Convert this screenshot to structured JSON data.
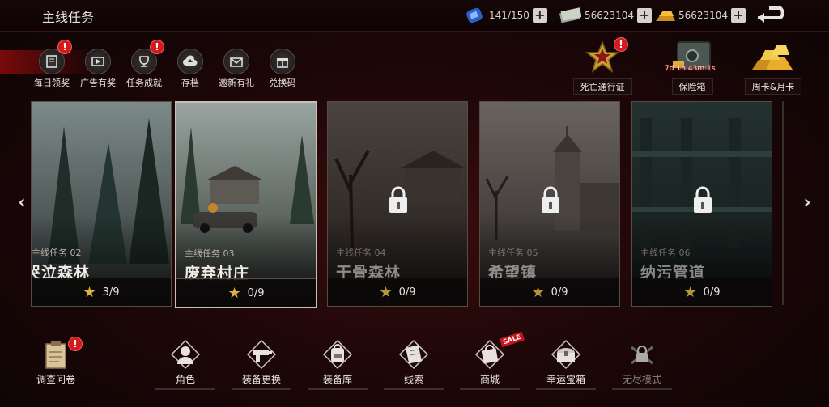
{
  "header": {
    "title": "主线任务"
  },
  "resources": [
    {
      "icon": "energy-can-icon",
      "value": "141/150"
    },
    {
      "icon": "cash-stack-icon",
      "value": "56623104"
    },
    {
      "icon": "gold-bars-icon",
      "value": "56623104"
    }
  ],
  "quick_actions": [
    {
      "label": "每日领奖",
      "icon": "daily-reward-icon",
      "badge": "!"
    },
    {
      "label": "广告有奖",
      "icon": "video-ad-icon",
      "badge": ""
    },
    {
      "label": "任务成就",
      "icon": "trophy-icon",
      "badge": "!"
    },
    {
      "label": "存档",
      "icon": "cloud-save-icon",
      "badge": ""
    },
    {
      "label": "邀新有礼",
      "icon": "invite-envelope-icon",
      "badge": ""
    },
    {
      "label": "兑换码",
      "icon": "gift-code-icon",
      "badge": ""
    }
  ],
  "features": [
    {
      "label": "死亡通行证",
      "icon": "star-emblem-icon",
      "badge": "!",
      "timer": ""
    },
    {
      "label": "保险箱",
      "icon": "safe-icon",
      "badge": "",
      "timer": "7d:1h:43m:1s"
    },
    {
      "label": "周卡&月卡",
      "icon": "gold-pile-icon",
      "badge": "",
      "timer": ""
    }
  ],
  "missions": [
    {
      "subtitle": "主线任务 02",
      "name": "哭泣森林",
      "stars": "3/9",
      "locked": false
    },
    {
      "subtitle": "主线任务 03",
      "name": "废弃村庄",
      "stars": "0/9",
      "locked": false
    },
    {
      "subtitle": "主线任务 04",
      "name": "干骨森林",
      "stars": "0/9",
      "locked": true
    },
    {
      "subtitle": "主线任务 05",
      "name": "希望镇",
      "stars": "0/9",
      "locked": true
    },
    {
      "subtitle": "主线任务 06",
      "name": "纳污管道",
      "stars": "0/9",
      "locked": true
    }
  ],
  "bottom_nav": [
    {
      "label": "调查问卷",
      "icon": "survey-clipboard-icon",
      "badge": "!"
    },
    {
      "label": "角色",
      "icon": "character-icon",
      "badge": ""
    },
    {
      "label": "装备更换",
      "icon": "weapon-swap-icon",
      "badge": ""
    },
    {
      "label": "装备库",
      "icon": "backpack-icon",
      "badge": ""
    },
    {
      "label": "线索",
      "icon": "notebook-icon",
      "badge": ""
    },
    {
      "label": "商城",
      "icon": "shop-bag-icon",
      "badge": "SALE"
    },
    {
      "label": "幸运宝箱",
      "icon": "lucky-chest-icon",
      "badge": ""
    },
    {
      "label": "无尽模式",
      "icon": "locked-crossed-guns-icon",
      "badge": ""
    }
  ],
  "colors": {
    "accent_red": "#d41b1b",
    "gold": "#e0b040",
    "background": "#1e0708"
  }
}
